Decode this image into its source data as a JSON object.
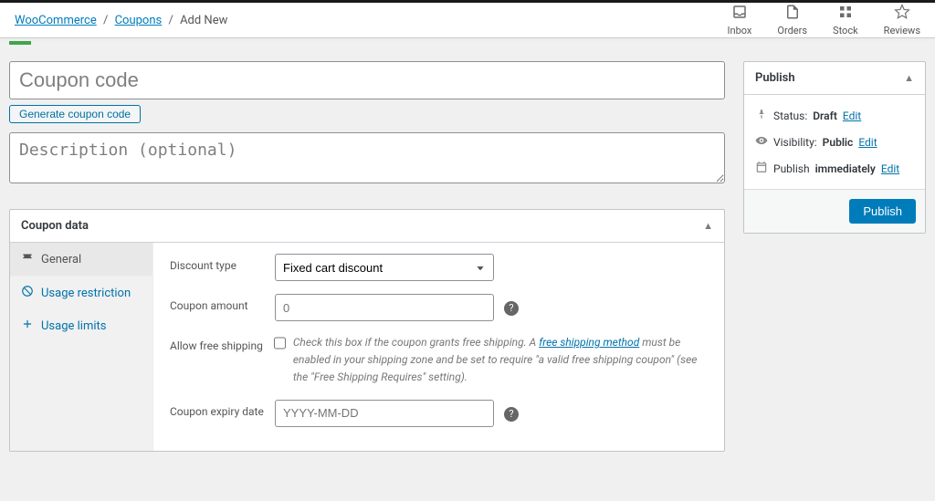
{
  "breadcrumb": {
    "root": "WooCommerce",
    "mid": "Coupons",
    "leaf": "Add New"
  },
  "topnav": {
    "inbox": "Inbox",
    "orders": "Orders",
    "stock": "Stock",
    "reviews": "Reviews"
  },
  "coupon": {
    "code_placeholder": "Coupon code",
    "generate_label": "Generate coupon code",
    "desc_placeholder": "Description (optional)"
  },
  "coupon_data": {
    "title": "Coupon data",
    "tabs": {
      "general": "General",
      "usage_restriction": "Usage restriction",
      "usage_limits": "Usage limits"
    },
    "fields": {
      "discount_type": {
        "label": "Discount type",
        "value": "Fixed cart discount"
      },
      "coupon_amount": {
        "label": "Coupon amount",
        "placeholder": "0"
      },
      "free_shipping": {
        "label": "Allow free shipping",
        "desc_prefix": "Check this box if the coupon grants free shipping. A ",
        "link": "free shipping method",
        "desc_suffix": " must be enabled in your shipping zone and be set to require \"a valid free shipping coupon\" (see the \"Free Shipping Requires\" setting)."
      },
      "expiry": {
        "label": "Coupon expiry date",
        "placeholder": "YYYY-MM-DD"
      }
    }
  },
  "publish": {
    "title": "Publish",
    "status_label": "Status:",
    "status_value": "Draft",
    "visibility_label": "Visibility:",
    "visibility_value": "Public",
    "publish_label": "Publish",
    "immediately": "immediately",
    "edit": "Edit",
    "button": "Publish"
  }
}
